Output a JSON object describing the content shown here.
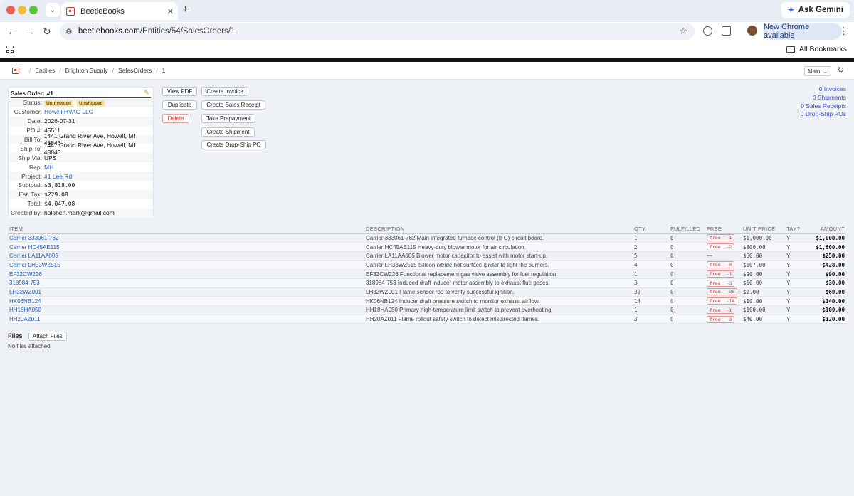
{
  "browser": {
    "tab_title": "BeetleBooks",
    "url_host": "beetlebooks.com",
    "url_path": "/Entities/54/SalesOrders/1",
    "ask_gemini": "Ask Gemini",
    "new_chrome": "New Chrome available",
    "all_bookmarks": "All Bookmarks"
  },
  "breadcrumb": [
    "Entities",
    "Brighton Supply",
    "SalesOrders",
    "1"
  ],
  "view_select": "Main",
  "order": {
    "header_label": "Sales Order:",
    "number": "#1",
    "status_label": "Status:",
    "badges": [
      "Uninvoiced",
      "Unshipped"
    ],
    "fields": [
      {
        "label": "Customer:",
        "value": "Howell HVAC LLC",
        "link": true
      },
      {
        "label": "Date:",
        "value": "2026-07-31"
      },
      {
        "label": "PO #:",
        "value": "45511"
      },
      {
        "label": "Bill To:",
        "value": "1441 Grand River Ave, Howell, MI 48843"
      },
      {
        "label": "Ship To:",
        "value": "1441 Grand River Ave, Howell, MI 48843"
      },
      {
        "label": "Ship Via:",
        "value": "UPS"
      },
      {
        "label": "Rep:",
        "value": "MH",
        "link": true
      },
      {
        "label": "Project:",
        "value": "#1 Lee Rd",
        "link": true
      },
      {
        "label": "Subtotal:",
        "value": "$3,818.00",
        "mono": true
      },
      {
        "label": "Est. Tax:",
        "value": "$229.08",
        "mono": true
      },
      {
        "label": "Total:",
        "value": "$4,047.08",
        "mono": true
      },
      {
        "label": "Created by:",
        "value": "halonen.mark@gmail.com"
      }
    ]
  },
  "actions": {
    "view_pdf": "View PDF",
    "duplicate": "Duplicate",
    "delete": "Delete",
    "create_invoice": "Create Invoice",
    "create_sales_receipt": "Create Sales Receipt",
    "take_prepayment": "Take Prepayment",
    "create_shipment": "Create Shipment",
    "create_drop_ship_po": "Create Drop-Ship PO"
  },
  "counts": [
    "0 Invoices",
    "0 Shipments",
    "0 Sales Receipts",
    "0 Drop-Ship POs"
  ],
  "table": {
    "headers": [
      "ITEM",
      "DESCRIPTION",
      "QTY",
      "FULFILLED",
      "FREE",
      "UNIT PRICE",
      "TAX?",
      "AMOUNT"
    ],
    "rows": [
      {
        "item": "Carrier 333061-762",
        "description": "Carrier 333061-762 Main integrated furnace control (IFC) circuit board.",
        "qty": "1",
        "fulfilled": "0",
        "free": "free: -1",
        "unit_price": "$1,000.00",
        "tax": "Y",
        "amount": "$1,000.00"
      },
      {
        "item": "Carrier HC45AE115",
        "description": "Carrier HC45AE115 Heavy-duty blower motor for air circulation.",
        "qty": "2",
        "fulfilled": "0",
        "free": "free: -2",
        "unit_price": "$800.00",
        "tax": "Y",
        "amount": "$1,600.00"
      },
      {
        "item": "Carrier LA11AA005",
        "description": "Carrier LA11AA005 Blower motor capacitor to assist with motor start-up.",
        "qty": "5",
        "fulfilled": "0",
        "free": "—",
        "unit_price": "$50.00",
        "tax": "Y",
        "amount": "$250.00"
      },
      {
        "item": "Carrier LH33WZ515",
        "description": "Carrier LH33WZ515 Silicon nitride hot surface igniter to light the burners.",
        "qty": "4",
        "fulfilled": "0",
        "free": "free: -4",
        "unit_price": "$107.00",
        "tax": "Y",
        "amount": "$428.00"
      },
      {
        "item": "EF32CW226",
        "description": "EF32CW226 Functional replacement gas valve assembly for fuel regulation.",
        "qty": "1",
        "fulfilled": "0",
        "free": "free: -1",
        "unit_price": "$90.00",
        "tax": "Y",
        "amount": "$90.00"
      },
      {
        "item": "318984-753",
        "description": "318984-753 Induced draft inducer motor assembly to exhaust flue gases.",
        "qty": "3",
        "fulfilled": "0",
        "free": "free: -3",
        "unit_price": "$10.00",
        "tax": "Y",
        "amount": "$30.00"
      },
      {
        "item": "LH32WZ001",
        "description": "LH32WZ001 Flame sensor rod to verify successful ignition.",
        "qty": "30",
        "fulfilled": "0",
        "free": "free: -30",
        "unit_price": "$2.00",
        "tax": "Y",
        "amount": "$60.00"
      },
      {
        "item": "HK06NB124",
        "description": "HK06NB124 Inducer draft pressure switch to monitor exhaust airflow.",
        "qty": "14",
        "fulfilled": "0",
        "free": "free: -14",
        "unit_price": "$10.00",
        "tax": "Y",
        "amount": "$140.00"
      },
      {
        "item": "HH18HA050",
        "description": "HH18HA050 Primary high-temperature limit switch to prevent overheating.",
        "qty": "1",
        "fulfilled": "0",
        "free": "free: -1",
        "unit_price": "$100.00",
        "tax": "Y",
        "amount": "$100.00"
      },
      {
        "item": "HH20AZ011",
        "description": "HH20AZ011 Flame rollout safety switch to detect misdirected flames.",
        "qty": "3",
        "fulfilled": "0",
        "free": "free: -3",
        "unit_price": "$40.00",
        "tax": "Y",
        "amount": "$120.00"
      }
    ]
  },
  "files": {
    "title": "Files",
    "attach_label": "Attach Files",
    "empty_text": "No files attached."
  }
}
